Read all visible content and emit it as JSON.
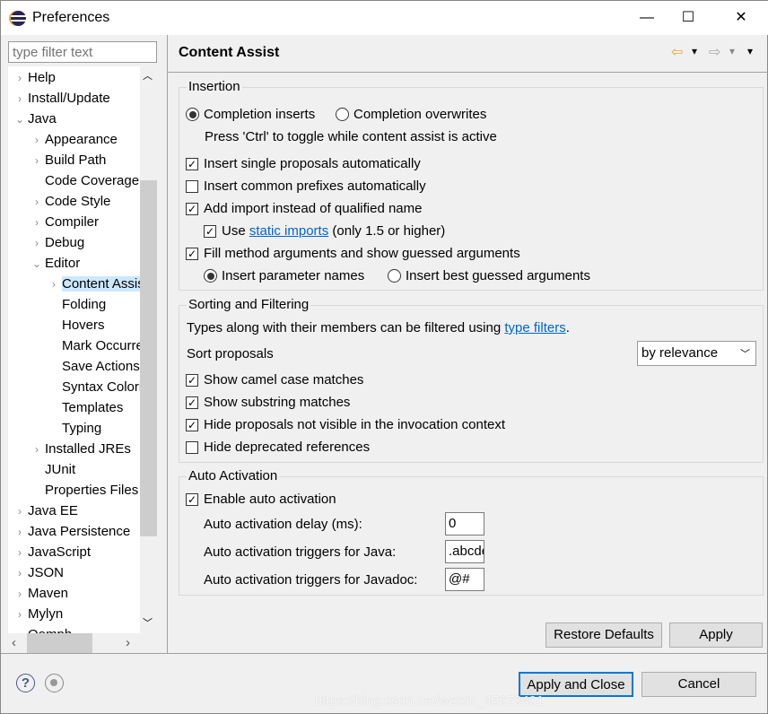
{
  "window": {
    "title": "Preferences",
    "minimize": "—",
    "maximize": "☐",
    "close": "✕"
  },
  "filter": {
    "placeholder": "type filter text"
  },
  "tree": [
    {
      "label": "Help",
      "level": 0,
      "chevron": "›"
    },
    {
      "label": "Install/Update",
      "level": 0,
      "chevron": "›"
    },
    {
      "label": "Java",
      "level": 0,
      "chevron": "⌄"
    },
    {
      "label": "Appearance",
      "level": 1,
      "chevron": "›"
    },
    {
      "label": "Build Path",
      "level": 1,
      "chevron": "›"
    },
    {
      "label": "Code Coverage",
      "level": 1,
      "chevron": ""
    },
    {
      "label": "Code Style",
      "level": 1,
      "chevron": "›"
    },
    {
      "label": "Compiler",
      "level": 1,
      "chevron": "›"
    },
    {
      "label": "Debug",
      "level": 1,
      "chevron": "›"
    },
    {
      "label": "Editor",
      "level": 1,
      "chevron": "⌄"
    },
    {
      "label": "Content Assist",
      "level": 2,
      "chevron": "›",
      "selected": true
    },
    {
      "label": "Folding",
      "level": 2,
      "chevron": ""
    },
    {
      "label": "Hovers",
      "level": 2,
      "chevron": ""
    },
    {
      "label": "Mark Occurrences",
      "level": 2,
      "chevron": ""
    },
    {
      "label": "Save Actions",
      "level": 2,
      "chevron": ""
    },
    {
      "label": "Syntax Coloring",
      "level": 2,
      "chevron": ""
    },
    {
      "label": "Templates",
      "level": 2,
      "chevron": ""
    },
    {
      "label": "Typing",
      "level": 2,
      "chevron": ""
    },
    {
      "label": "Installed JREs",
      "level": 1,
      "chevron": "›"
    },
    {
      "label": "JUnit",
      "level": 1,
      "chevron": ""
    },
    {
      "label": "Properties Files Editor",
      "level": 1,
      "chevron": ""
    },
    {
      "label": "Java EE",
      "level": 0,
      "chevron": "›"
    },
    {
      "label": "Java Persistence",
      "level": 0,
      "chevron": "›"
    },
    {
      "label": "JavaScript",
      "level": 0,
      "chevron": "›"
    },
    {
      "label": "JSON",
      "level": 0,
      "chevron": "›"
    },
    {
      "label": "Maven",
      "level": 0,
      "chevron": "›"
    },
    {
      "label": "Mylyn",
      "level": 0,
      "chevron": "›"
    },
    {
      "label": "Oomph",
      "level": 0,
      "chevron": "›"
    }
  ],
  "page": {
    "title": "Content Assist",
    "back": "⇦",
    "forward": "⇨",
    "menu": "▾"
  },
  "insertion": {
    "label": "Insertion",
    "radio_inserts": "Completion inserts",
    "radio_overwrites": "Completion overwrites",
    "hint": "Press 'Ctrl' to toggle while content assist is active",
    "single": "Insert single proposals automatically",
    "prefixes": "Insert common prefixes automatically",
    "import": "Add import instead of qualified name",
    "static_use": "Use",
    "static_link": "static imports",
    "static_suffix": "(only 1.5 or higher)",
    "fill": "Fill method arguments and show guessed arguments",
    "param_names": "Insert parameter names",
    "best_guess": "Insert best guessed arguments"
  },
  "sorting": {
    "label": "Sorting and Filtering",
    "types_text": "Types along with their members can be filtered using",
    "types_link": "type filters",
    "period": ".",
    "sort_label": "Sort proposals",
    "sort_value": "by relevance",
    "camel": "Show camel case matches",
    "substring": "Show substring matches",
    "hide_invisible": "Hide proposals not visible in the invocation context",
    "hide_deprecated": "Hide deprecated references"
  },
  "auto": {
    "label": "Auto Activation",
    "enable": "Enable auto activation",
    "delay_label": "Auto activation delay (ms):",
    "delay_value": "0",
    "java_label": "Auto activation triggers for Java:",
    "java_value": ".abcdefghijklmnopqrstuvwxyz",
    "javadoc_label": "Auto activation triggers for Javadoc:",
    "javadoc_value": "@#"
  },
  "buttons": {
    "restore": "Restore Defaults",
    "apply": "Apply",
    "apply_close": "Apply and Close",
    "cancel": "Cancel"
  },
  "watermark": "https://blog.csdn.net/weixin_45673401"
}
